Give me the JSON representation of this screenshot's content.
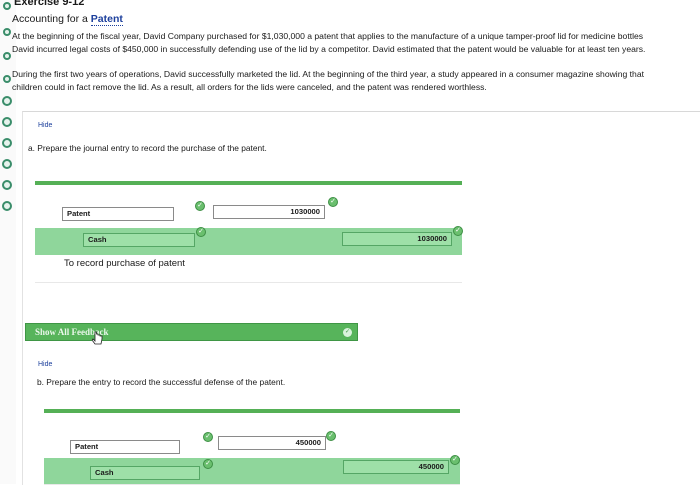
{
  "header": {
    "exercise_title": "Exercise 9-12",
    "subtitle_prefix": "Accounting for a ",
    "subtitle_link": "Patent"
  },
  "intro": {
    "line1": "At the beginning of the fiscal year, David Company purchased for $1,030,000 a patent that applies to the manufacture of a unique tamper-proof lid for medicine bottles",
    "line2": "David incurred legal costs of $450,000 in successfully defending use of the lid by a competitor. David estimated that the patent would be valuable for at least ten years.",
    "line3": "During the first two years of operations, David successfully marketed the lid. At the beginning of the third year, a study appeared in a consumer magazine showing that",
    "line4": "children could in fact remove the lid. As a result, all orders for the lids were canceled, and the patent was rendered worthless."
  },
  "part_a": {
    "hide": "Hide",
    "question": "a.  Prepare the journal entry to record the purchase of the patent.",
    "debit_account": "Patent",
    "debit_amount": "1030000",
    "credit_account": "Cash",
    "credit_amount": "1030000",
    "description": "To record purchase of patent"
  },
  "feedback": {
    "label": "Show All Feedback"
  },
  "part_b": {
    "hide": "Hide",
    "question": "b.  Prepare the entry to record the successful defense of the patent.",
    "debit_account": "Patent",
    "debit_amount": "450000",
    "credit_account": "Cash",
    "credit_amount": "450000"
  },
  "colors": {
    "accent_green": "#55b056",
    "link_blue": "#1c3f9c",
    "cell_green": "#9ee0a8"
  }
}
